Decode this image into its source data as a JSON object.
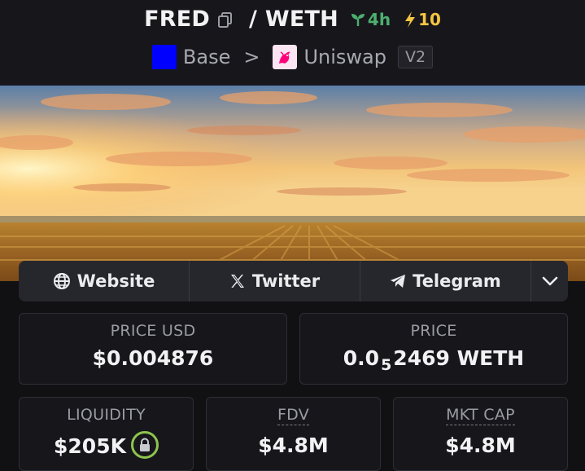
{
  "header": {
    "base_token": "FRED",
    "separator": "/",
    "quote_token": "WETH",
    "age": "4h",
    "boosts": "10",
    "chain": "Base",
    "dex": "Uniswap",
    "version": "V2",
    "chain_color": "#0000ff"
  },
  "links": {
    "website": "Website",
    "twitter": "Twitter",
    "telegram": "Telegram"
  },
  "stats": {
    "price_usd_label": "PRICE USD",
    "price_usd": "$0.004876",
    "price_label": "PRICE",
    "price_prefix": "0.0",
    "price_zeros": "5",
    "price_digits": "2469 WETH",
    "liquidity_label": "LIQUIDITY",
    "liquidity": "$205K",
    "fdv_label": "FDV",
    "fdv": "$4.8M",
    "mktcap_label": "MKT CAP",
    "mktcap": "$4.8M"
  },
  "colors": {
    "age_green": "#4caf70",
    "boost_yellow": "#f5c542",
    "lock_green": "#8ec44f"
  }
}
